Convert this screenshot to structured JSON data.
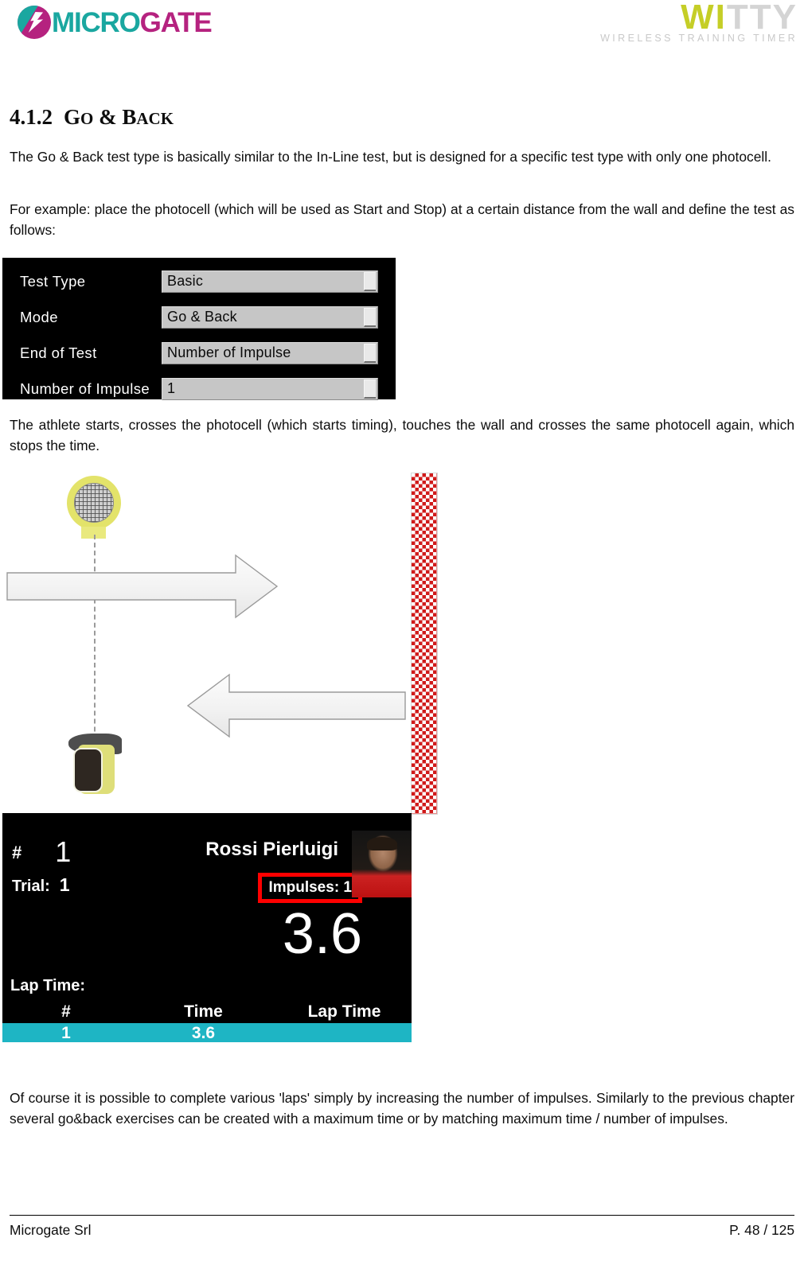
{
  "header": {
    "microgate_logo": {
      "icon": "microgate-circle-bolt-icon",
      "text_part1": "MICRO",
      "text_part2": "GATE",
      "color_teal": "#1aa7a0",
      "color_magenta": "#b5227f"
    },
    "witty_logo": {
      "text_part1": "WI",
      "text_part2": "TTY",
      "subtitle": "WIRELESS TRAINING TIMER",
      "color_yellow": "#c5ce27",
      "color_gray": "#d4d4d4"
    }
  },
  "section": {
    "number": "4.1.2",
    "title_first": "G",
    "title_first_rest": "O",
    "title_amp": " & ",
    "title_second": "B",
    "title_second_rest": "ACK",
    "title_full": "4.1.2  Go & Back"
  },
  "paragraphs": {
    "p1": "The Go & Back test type is basically similar to the In-Line test, but is designed for a specific test type with only one photocell.",
    "p2": "For example: place the photocell (which will be used as Start and Stop) at a certain distance from the wall and define the test as follows:",
    "p3": "The athlete starts, crosses the photocell (which starts timing), touches the wall and crosses the same photocell again, which stops the time.",
    "p4": "Of course it is possible to complete various 'laps' simply by increasing the number of impulses. Similarly to the previous chapter several go&back exercises can be created with a maximum time or by matching maximum time / number of impulses."
  },
  "settings_panel": {
    "rows": [
      {
        "label": "Test Type",
        "value": "Basic",
        "icon": "dropdown-arrow-icon"
      },
      {
        "label": "Mode",
        "value": "Go & Back",
        "icon": "dropdown-arrow-icon"
      },
      {
        "label": "End of Test",
        "value": "Number of Impulse",
        "icon": "dropdown-arrow-icon"
      },
      {
        "label": "Number of Impulse",
        "value": "1",
        "icon": "dropdown-arrow-icon"
      }
    ]
  },
  "diagram": {
    "photocell_icon": "photocell-icon",
    "tripod_icon": "reflector-tripod-icon",
    "wall_icon": "checkered-wall-icon",
    "arrow_go_icon": "arrow-right-icon",
    "arrow_back_icon": "arrow-left-icon",
    "beam_line_icon": "dashed-beam-line-icon",
    "wall_color": "#d01a1a"
  },
  "result_display": {
    "bib_label": "#",
    "bib_value": "1",
    "trial_label": "Trial:",
    "trial_value": "1",
    "athlete_name": "Rossi  Pierluigi",
    "impulses_text": "Impulses: 1",
    "impulses_highlight_color": "#ff0000",
    "main_time": "3.6",
    "lap_time_label": "Lap  Time:",
    "columns": [
      "#",
      "Time",
      "Lap  Time"
    ],
    "rows": [
      {
        "num": "1",
        "time": "3.6",
        "lap": ""
      }
    ],
    "row_highlight_color": "#1eb5c4",
    "photo_icon": "athlete-photo"
  },
  "footer": {
    "left": "Microgate Srl",
    "right": "P. 48 / 125"
  }
}
